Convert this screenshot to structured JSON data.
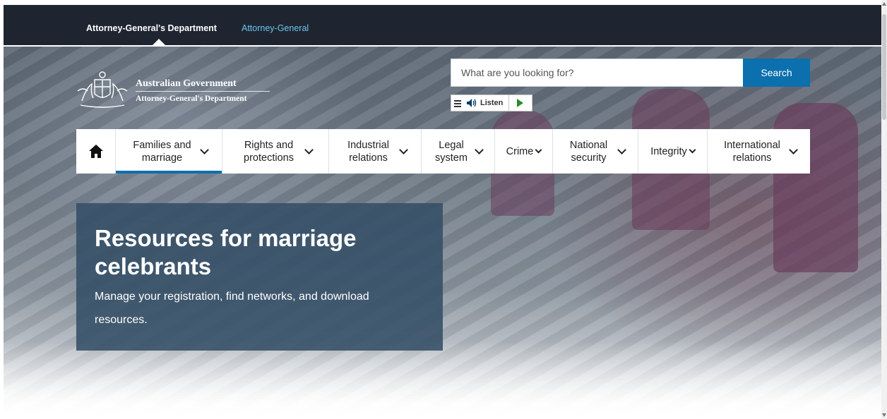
{
  "topbar": {
    "active_tab": "Attorney-General's Department",
    "link_tab": "Attorney-General"
  },
  "logo": {
    "government": "Australian Government",
    "department": "Attorney-General's Department"
  },
  "search": {
    "placeholder": "What are you looking for?",
    "value": "",
    "button_label": "Search"
  },
  "listen": {
    "label": "Listen"
  },
  "nav": {
    "home_icon": "home-icon",
    "items": [
      {
        "label": "Families and marriage",
        "active": true
      },
      {
        "label": "Rights and protections",
        "active": false
      },
      {
        "label": "Industrial relations",
        "active": false
      },
      {
        "label": "Legal system",
        "active": false
      },
      {
        "label": "Crime",
        "active": false
      },
      {
        "label": "National security",
        "active": false
      },
      {
        "label": "Integrity",
        "active": false
      },
      {
        "label": "International relations",
        "active": false
      }
    ]
  },
  "hero": {
    "title": "Resources for marriage celebrants",
    "description": "Manage your registration, find networks, and download resources."
  },
  "colors": {
    "topbar_bg": "#1f2530",
    "link": "#6cc7ee",
    "accent": "#0b70ad",
    "card_bg": "#344e67",
    "play_green": "#2d8a2d"
  }
}
